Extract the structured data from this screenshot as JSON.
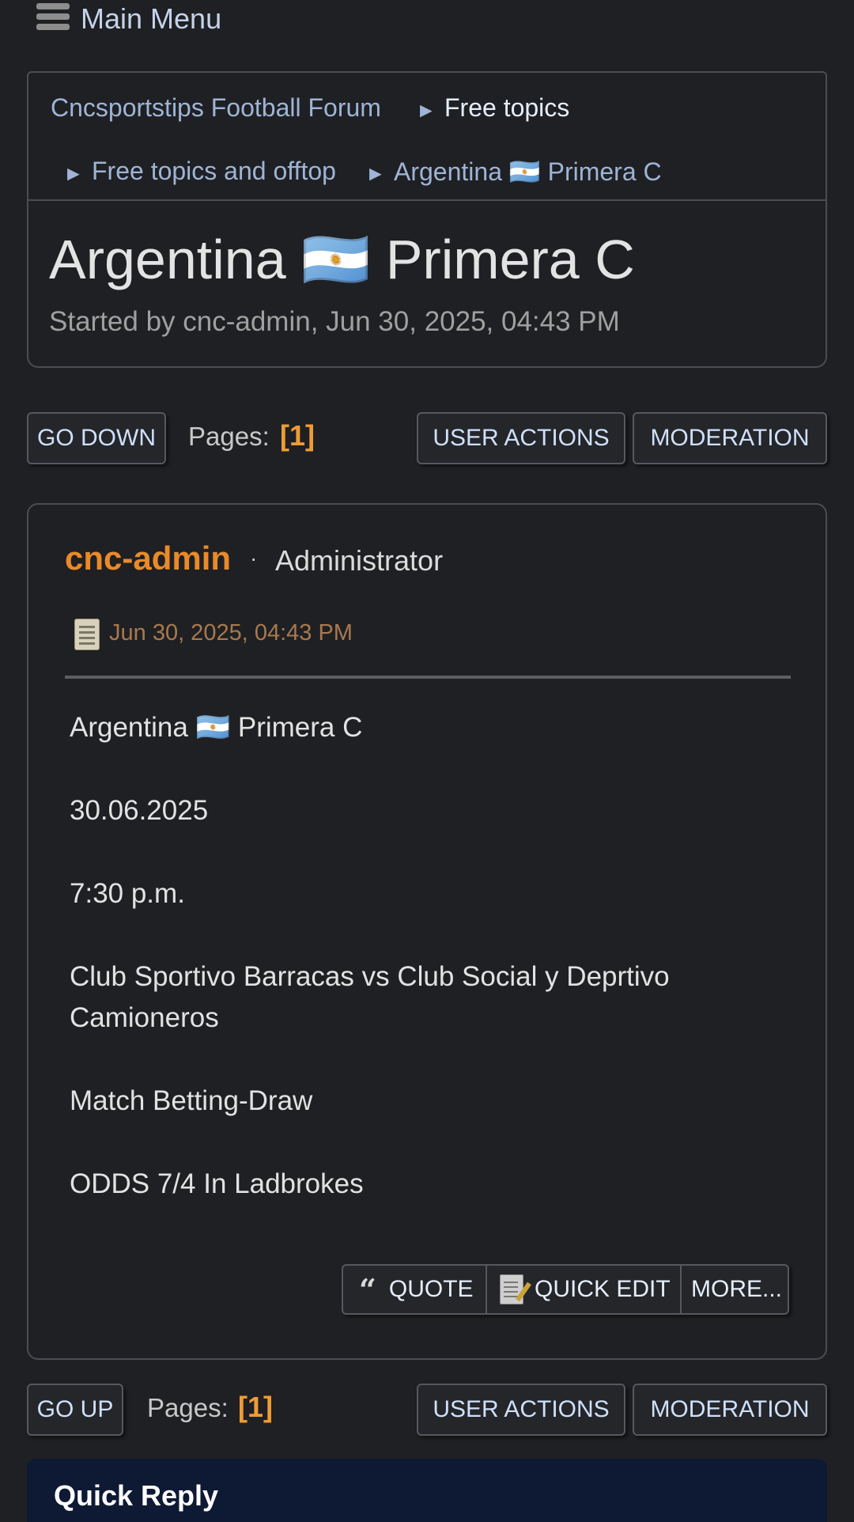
{
  "topbar": {
    "menu_label": "Main Menu",
    "menu_icon": "hamburger-icon"
  },
  "breadcrumb": {
    "items": [
      "Cncsportstips Football Forum",
      "Free topics",
      "Free topics and offtop",
      "Argentina 🇦🇷 Primera C"
    ],
    "separator": "►"
  },
  "topic": {
    "title": "Argentina 🇦🇷 Primera C",
    "started_by": "Started by cnc-admin, Jun 30, 2025, 04:43 PM"
  },
  "top_controls": {
    "go_down": "GO DOWN",
    "pages_label": "Pages:",
    "current_page": "[1]",
    "user_actions": "USER ACTIONS",
    "moderation": "MODERATION"
  },
  "post": {
    "author": "cnc-admin",
    "dot": "·",
    "role": "Administrator",
    "date": "Jun 30, 2025, 04:43 PM",
    "body": [
      "Argentina 🇦🇷 Primera C",
      "30.06.2025",
      "7:30 p.m.",
      "Club Sportivo Barracas vs Club Social y Deprtivo",
      "Camioneros",
      "Match Betting-Draw",
      "ODDS 7/4 In Ladbrokes"
    ],
    "actions": {
      "quote": "QUOTE",
      "quick_edit": "QUICK EDIT",
      "more": "MORE..."
    }
  },
  "bottom_controls": {
    "go_up": "GO UP",
    "pages_label": "Pages:",
    "current_page": "[1]",
    "user_actions": "USER ACTIONS",
    "moderation": "MODERATION"
  },
  "quick_reply": {
    "title": "Quick Reply"
  },
  "colors": {
    "background": "#1f2023",
    "link": "#9fb4d6",
    "author": "#e98a2a",
    "page_current": "#ef9c36",
    "date": "#a8794e",
    "quick_reply_bg": "#0e1a33"
  }
}
